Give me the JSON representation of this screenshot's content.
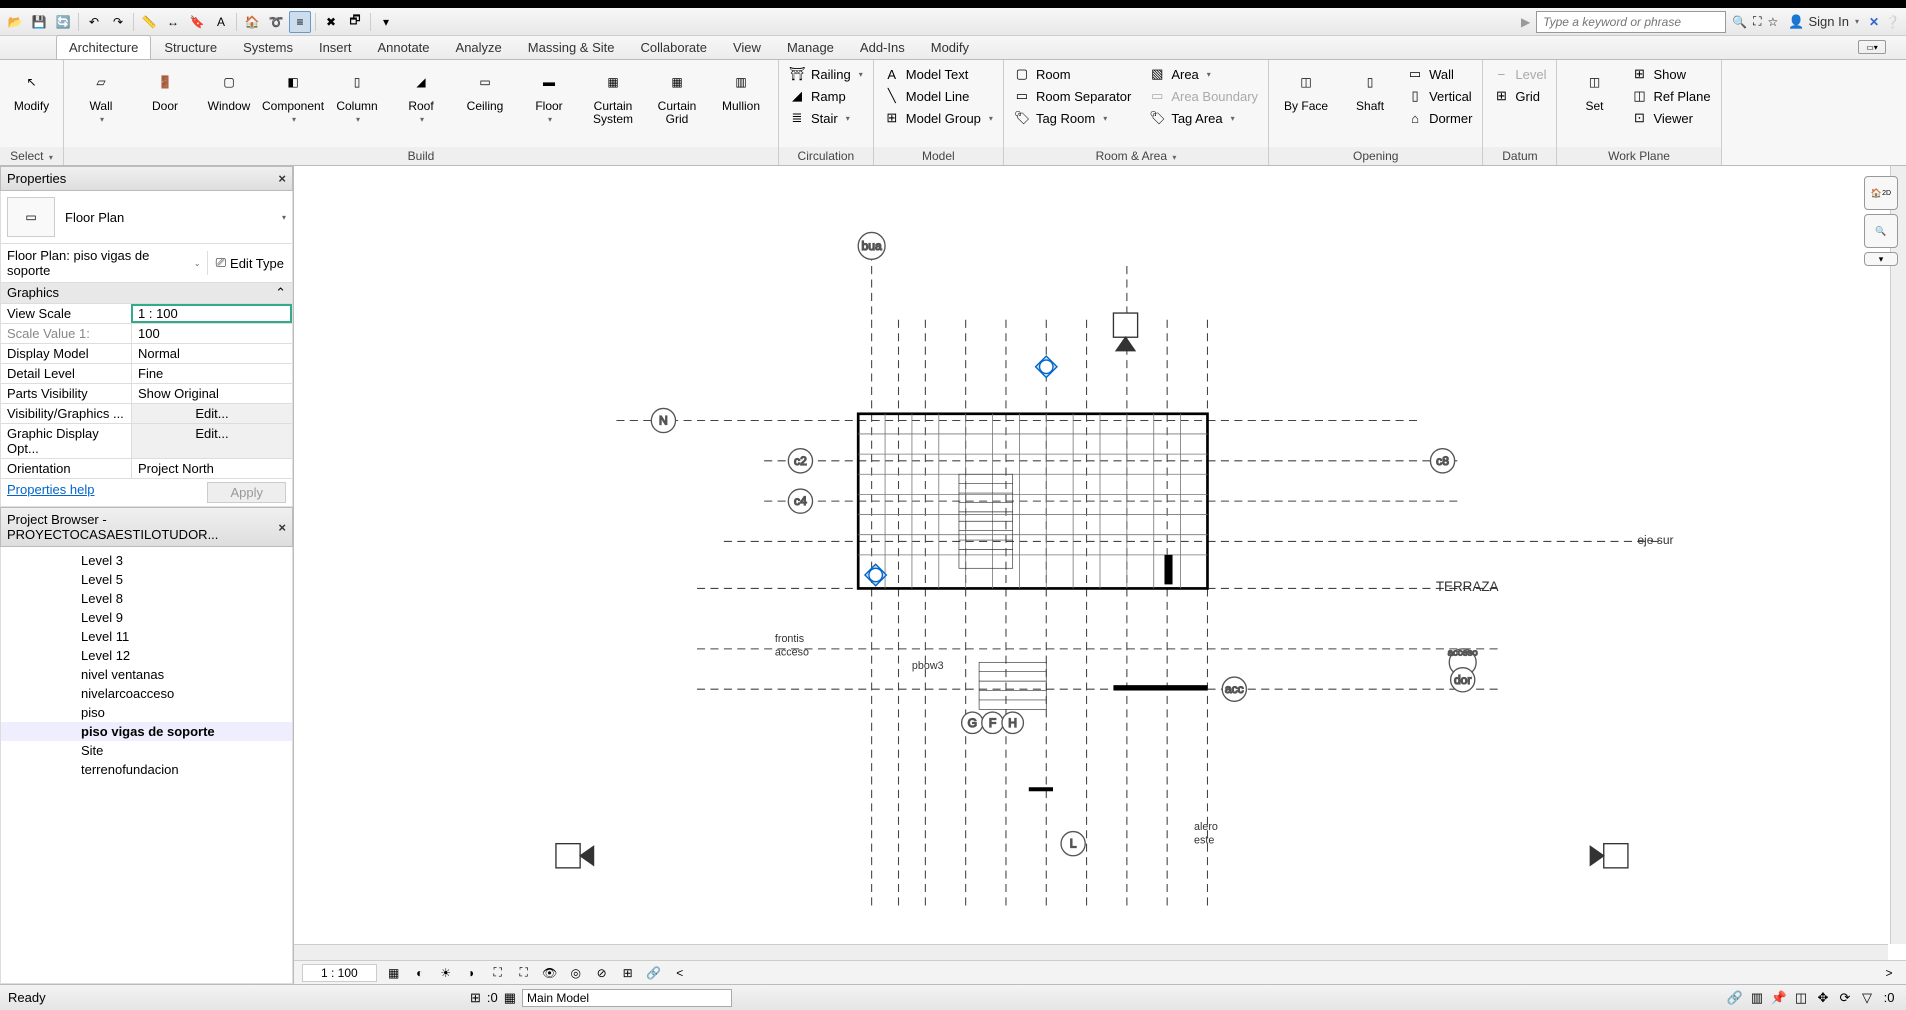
{
  "qat": {
    "search_placeholder": "Type a keyword or phrase",
    "signin": "Sign In"
  },
  "tabs": [
    "Architecture",
    "Structure",
    "Systems",
    "Insert",
    "Annotate",
    "Analyze",
    "Massing & Site",
    "Collaborate",
    "View",
    "Manage",
    "Add-Ins",
    "Modify"
  ],
  "active_tab": 0,
  "ribbon": {
    "select": {
      "modify": "Modify",
      "title": "Select"
    },
    "build": {
      "title": "Build",
      "items": [
        "Wall",
        "Door",
        "Window",
        "Component",
        "Column",
        "Roof",
        "Ceiling",
        "Floor",
        "Curtain System",
        "Curtain Grid",
        "Mullion"
      ]
    },
    "circulation": {
      "title": "Circulation",
      "railing": "Railing",
      "ramp": "Ramp",
      "stair": "Stair"
    },
    "model": {
      "title": "Model",
      "text": "Model Text",
      "line": "Model Line",
      "group": "Model Group"
    },
    "room_area": {
      "title": "Room & Area",
      "room": "Room",
      "sep": "Room Separator",
      "tagroom": "Tag Room",
      "area": "Area",
      "bound": "Area Boundary",
      "tagarea": "Tag Area"
    },
    "opening": {
      "title": "Opening",
      "byface": "By Face",
      "shaft": "Shaft",
      "wall": "Wall",
      "vertical": "Vertical",
      "dormer": "Dormer"
    },
    "datum": {
      "title": "Datum",
      "level": "Level",
      "grid": "Grid"
    },
    "workplane": {
      "title": "Work Plane",
      "set": "Set",
      "show": "Show",
      "ref": "Ref Plane",
      "viewer": "Viewer"
    }
  },
  "properties": {
    "title": "Properties",
    "type": "Floor Plan",
    "instance": "Floor Plan: piso  vigas de soporte",
    "edit_type": "Edit Type",
    "group": "Graphics",
    "rows": [
      {
        "k": "View Scale",
        "v": "1 : 100",
        "input": true
      },
      {
        "k": "Scale Value    1:",
        "v": "100",
        "dim": true
      },
      {
        "k": "Display Model",
        "v": "Normal"
      },
      {
        "k": "Detail Level",
        "v": "Fine"
      },
      {
        "k": "Parts Visibility",
        "v": "Show Original"
      },
      {
        "k": "Visibility/Graphics ...",
        "v": "Edit...",
        "btn": true
      },
      {
        "k": "Graphic Display Opt...",
        "v": "Edit...",
        "btn": true
      },
      {
        "k": "Orientation",
        "v": "Project North"
      }
    ],
    "help": "Properties help",
    "apply": "Apply"
  },
  "browser": {
    "title": "Project Browser - PROYECTOCASAESTILOTUDOR...",
    "items": [
      {
        "label": "Level 3"
      },
      {
        "label": "Level 5"
      },
      {
        "label": "Level 8"
      },
      {
        "label": "Level 9"
      },
      {
        "label": "Level 11"
      },
      {
        "label": "Level 12"
      },
      {
        "label": "nivel ventanas"
      },
      {
        "label": "nivelarcoacceso"
      },
      {
        "label": "piso"
      },
      {
        "label": "piso  vigas de soporte",
        "bold": true
      },
      {
        "label": "Site"
      },
      {
        "label": "terrenofundacion"
      }
    ]
  },
  "viewbar": {
    "scale": "1 : 100"
  },
  "status": {
    "text": "Ready",
    "zero": ":0",
    "main_model": "Main Model"
  },
  "drawing": {
    "grids_top": [
      "bua"
    ],
    "grids_left": [
      "N",
      "c2",
      "c4"
    ],
    "grids_right": [
      "c8",
      "acceso",
      "dor"
    ],
    "grids_bottom": [
      "G",
      "F",
      "H",
      "L",
      "acc"
    ],
    "labels": [
      "TERRAZA",
      "frontis acceso",
      "pbow3",
      "alero este",
      "eje sur"
    ]
  }
}
